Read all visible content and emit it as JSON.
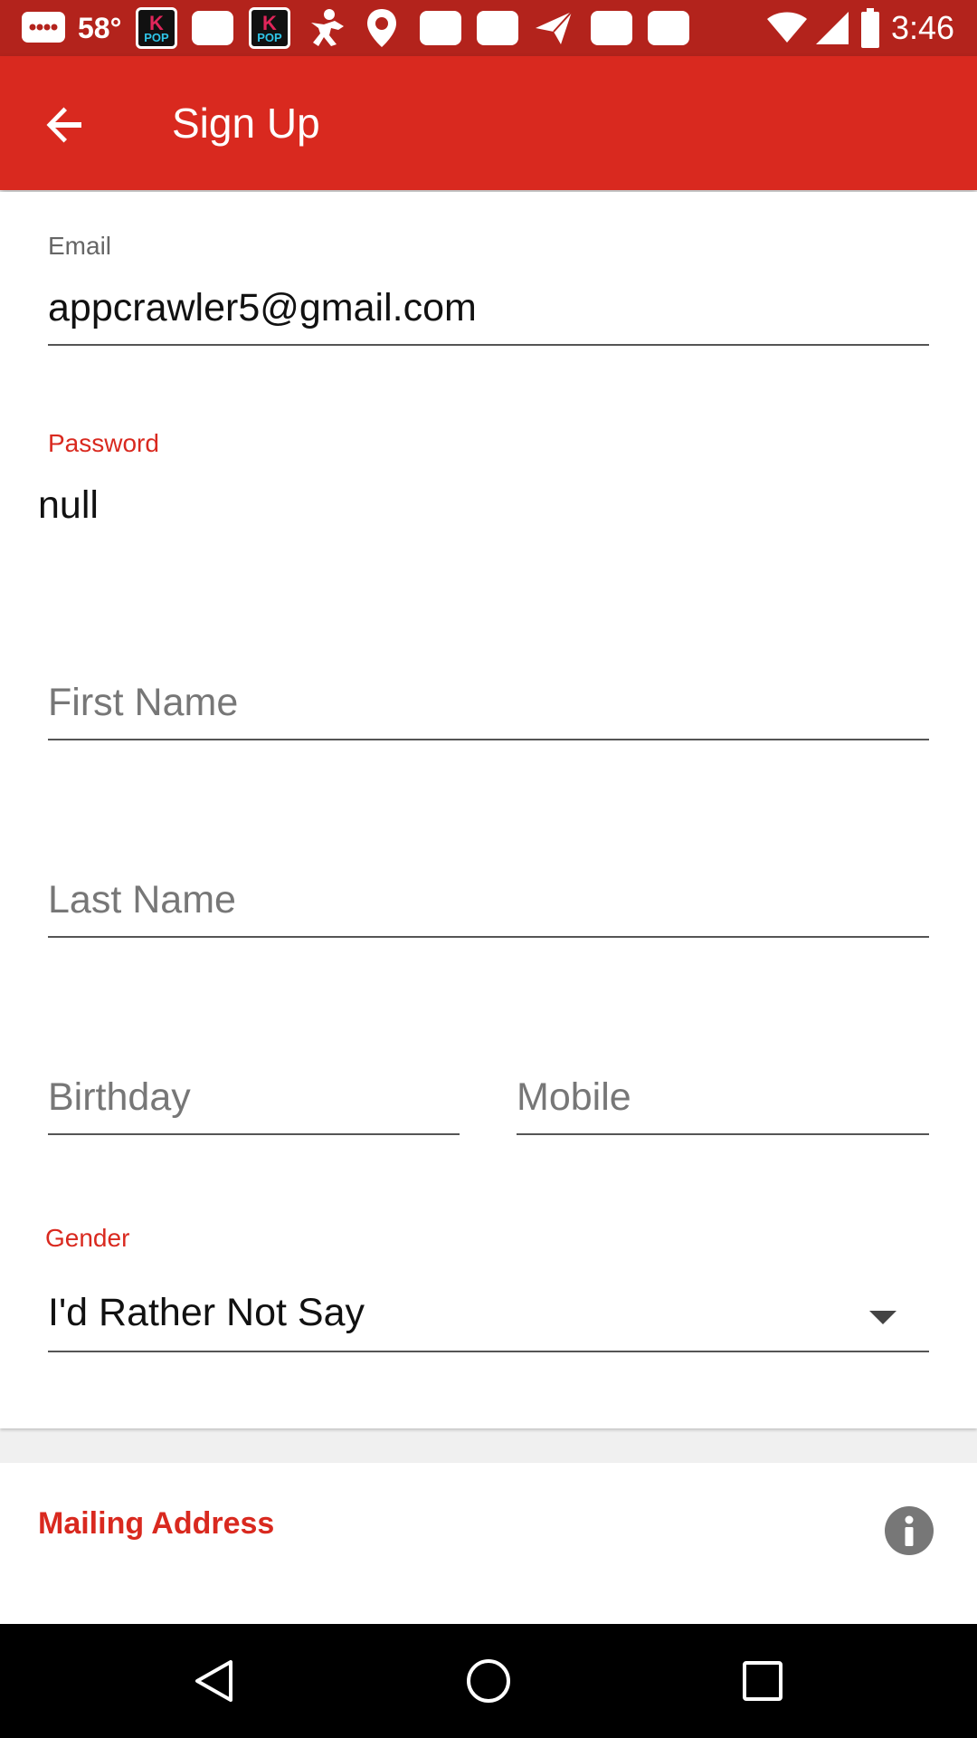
{
  "status_bar": {
    "temperature": "58°",
    "time": "3:46",
    "pop_icon": {
      "top": "K",
      "bottom": "POP"
    },
    "icons": [
      "messages-icon",
      "popcorn-pop-icon",
      "notification-icon",
      "popcorn-pop-icon",
      "activity-icon",
      "location-icon",
      "notification-icon",
      "notification-icon",
      "send-icon",
      "notification-icon",
      "notification-icon"
    ]
  },
  "app_bar": {
    "title": "Sign Up",
    "back_icon": "arrow-back-icon",
    "color": "#d9291f"
  },
  "form": {
    "email": {
      "label": "Email",
      "value": "appcrawler5@gmail.com"
    },
    "password": {
      "label": "Password",
      "value": "null"
    },
    "first_name": {
      "placeholder": "First Name"
    },
    "last_name": {
      "placeholder": "Last Name"
    },
    "birthday": {
      "placeholder": "Birthday"
    },
    "mobile": {
      "placeholder": "Mobile"
    },
    "gender": {
      "label": "Gender",
      "value": "I'd Rather Not Say"
    }
  },
  "mailing_address": {
    "title": "Mailing Address",
    "info_icon": "info-icon"
  },
  "nav_bar": {
    "icons": [
      "back-triangle-icon",
      "home-circle-icon",
      "recents-square-icon"
    ]
  },
  "colors": {
    "accent": "#d9291f",
    "status_bar": "#b3231c"
  }
}
